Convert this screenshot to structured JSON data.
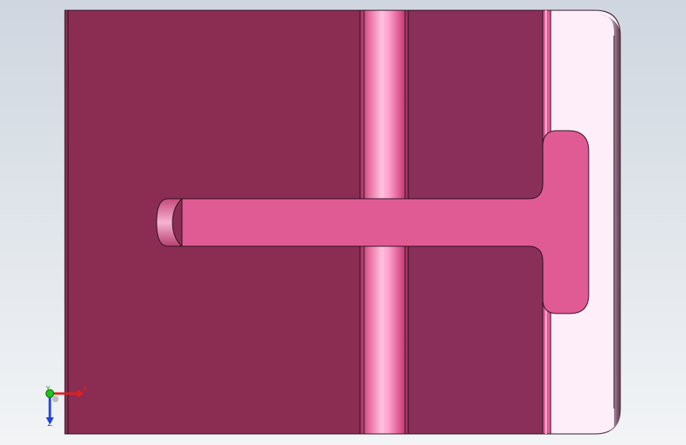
{
  "viewport": {
    "background_top": "#cfd6df",
    "background_bottom": "#f2f4f6"
  },
  "model": {
    "body_color": "#8b2d53",
    "body_right_color": "#8a2f5a",
    "edge_color": "#2a0f1c",
    "rod_highlight_color": "#ff9ecb",
    "slot_color": "#e05a94",
    "plate_color": "#fdeefa"
  },
  "triad": {
    "x_label": "X",
    "y_label": "Y",
    "z_label": "Z",
    "x_color": "#e02020",
    "y_color": "#20c020",
    "z_color": "#2040e0"
  }
}
